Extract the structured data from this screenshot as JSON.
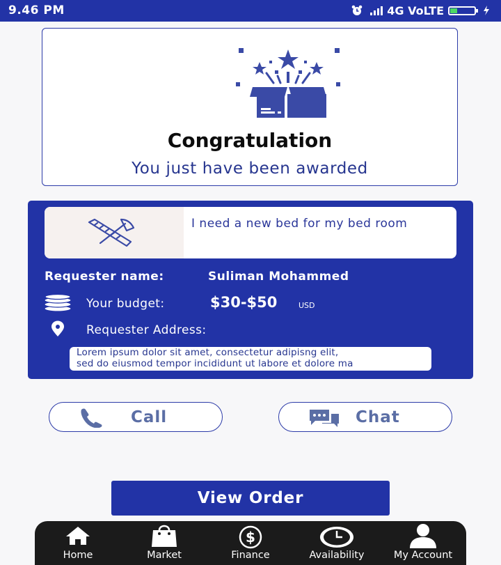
{
  "status_bar": {
    "time": "9.46 PM",
    "network": "4G VoLTE",
    "icons": [
      "alarm-icon",
      "signal-icon",
      "battery-icon",
      "charging-icon"
    ]
  },
  "award": {
    "title": "Congratulation",
    "subtitle": "You just have been awarded",
    "icon": "gift-box-icon"
  },
  "job": {
    "title": "I need a new bed for my bed room",
    "icon": "tools-icon",
    "requester_label": "Requester name:",
    "requester_name": "Suliman Mohammed",
    "budget_label": "Your budget:",
    "budget_amount": "$30-$50",
    "budget_currency": "USD",
    "address_label": "Requester Address:",
    "address_line1": "Lorem ipsum dolor sit amet, consectetur adipisng elit,",
    "address_line2": "sed do eiusmod tempor incididunt ut labore et dolore ma"
  },
  "actions": {
    "call_label": "Call",
    "chat_label": "Chat",
    "view_order_label": "View Order"
  },
  "bottom_nav": {
    "items": [
      {
        "label": "Home",
        "icon": "home-icon"
      },
      {
        "label": "Market",
        "icon": "shopping-bag-icon"
      },
      {
        "label": "Finance",
        "icon": "dollar-icon"
      },
      {
        "label": "Availability",
        "icon": "clock-icon"
      },
      {
        "label": "My Account",
        "icon": "user-icon"
      }
    ]
  },
  "colors": {
    "primary": "#2233a6",
    "accent_text": "#26358f",
    "icon_muted": "#5b6ea5",
    "nav_background": "#1b1b1b"
  }
}
